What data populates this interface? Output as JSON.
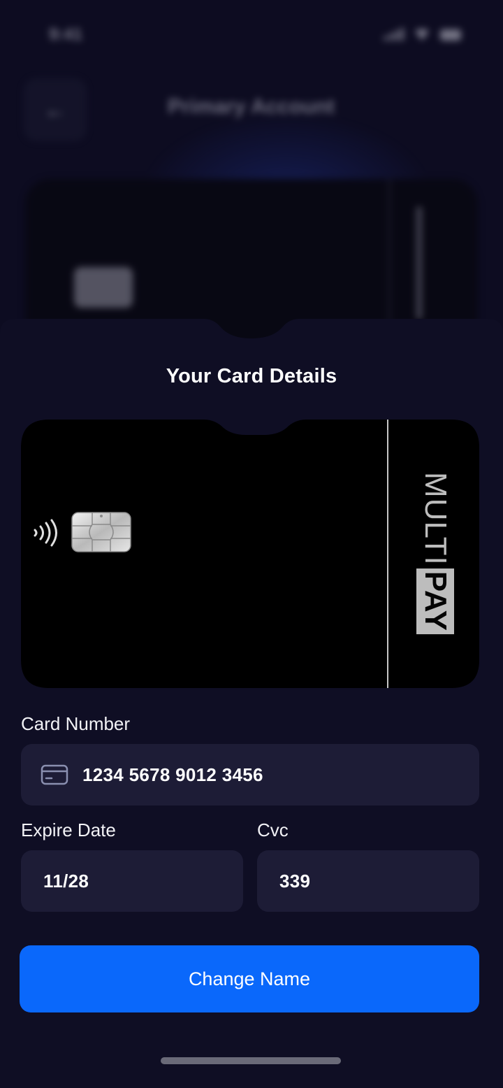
{
  "status_bar": {
    "time": "9:41"
  },
  "background": {
    "back_icon": "arrow-left-icon",
    "title": "Primary Account"
  },
  "sheet": {
    "title": "Your Card Details"
  },
  "card": {
    "brand_text_1": "MULTI",
    "brand_text_2": "PAY",
    "nfc_icon": "contactless-icon",
    "chip_icon": "chip-icon"
  },
  "form": {
    "card_number": {
      "label": "Card Number",
      "value": "1234 5678 9012 3456",
      "icon": "credit-card-icon"
    },
    "expire_date": {
      "label": "Expire Date",
      "value": "11/28"
    },
    "cvc": {
      "label": "Cvc",
      "value": "339"
    }
  },
  "actions": {
    "primary_label": "Change Name"
  },
  "colors": {
    "background": "#0d0c21",
    "sheet": "#0f0e24",
    "field": "#1d1c36",
    "accent": "#0a68fb",
    "card": "#000000"
  }
}
